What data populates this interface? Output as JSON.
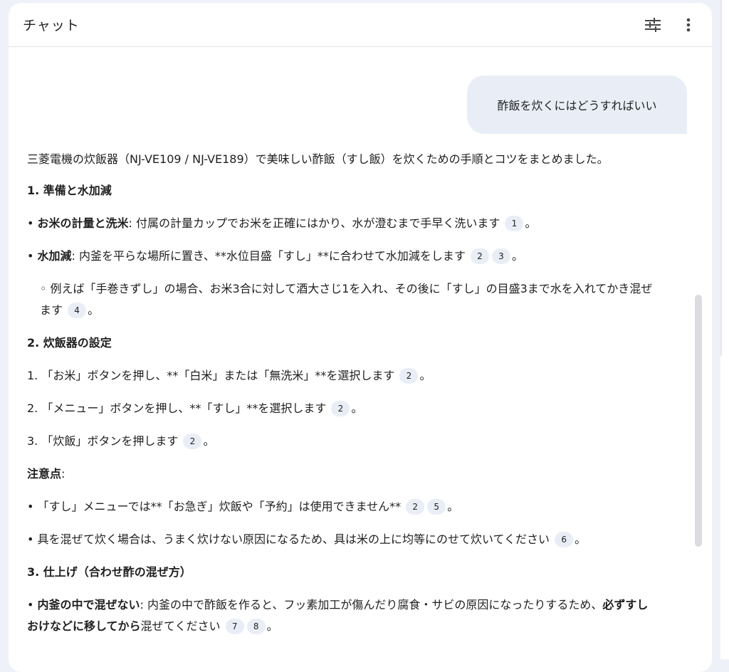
{
  "header": {
    "title": "チャット",
    "tune_icon": "tune-icon",
    "more_icon": "more-vert-icon"
  },
  "user_message": "酢飯を炊くにはどうすればいい",
  "answer": {
    "intro": "三菱電機の炊飯器（NJ-VE109 / NJ-VE189）で美味しい酢飯（すし飯）を炊くための手順とコツをまとめました。",
    "section1": "1. 準備と水加減",
    "s1_b1_bold": "お米の計量と洗米",
    "s1_b1_text": ": 付属の計量カップでお米を正確にはかり、水が澄むまで手早く洗います",
    "s1_b1_cites": [
      "1"
    ],
    "s1_b2_bold": "水加減",
    "s1_b2_text": ": 内釜を平らな場所に置き、**水位目盛「すし」**に合わせて水加減をします",
    "s1_b2_cites": [
      "2",
      "3"
    ],
    "s1_sub_text": "例えば「手巻きずし」の場合、お米3合に対して酒大さじ1を入れ、その後に「すし」の目盛3まで水を入れてかき混ぜます",
    "s1_sub_cites": [
      "4"
    ],
    "section2": "2. 炊飯器の設定",
    "s2_1": "1. 「お米」ボタンを押し、**「白米」または「無洗米」**を選択します",
    "s2_1_cites": [
      "2"
    ],
    "s2_2": "2. 「メニュー」ボタンを押し、**「すし」**を選択します",
    "s2_2_cites": [
      "2"
    ],
    "s2_3": "3. 「炊飯」ボタンを押します",
    "s2_3_cites": [
      "2"
    ],
    "note_heading": "注意点",
    "note_colon": ":",
    "note_b1": "「すし」メニューでは**「お急ぎ」炊飯や「予約」は使用できません**",
    "note_b1_cites": [
      "2",
      "5"
    ],
    "note_b2": "具を混ぜて炊く場合は、うまく炊けない原因になるため、具は米の上に均等にのせて炊いてください",
    "note_b2_cites": [
      "6"
    ],
    "section3": "3. 仕上げ（合わせ酢の混ぜ方）",
    "s3_b1_bold": "内釜の中で混ぜない",
    "s3_b1_text": ": 内釜の中で酢飯を作ると、フッ素加工が傷んだり腐食・サビの原因になったりするため、",
    "s3_b1_bold2": "必ずすしおけなどに移してから",
    "s3_b1_text2": "混ぜてください",
    "s3_b1_cites": [
      "7",
      "8"
    ],
    "period": "。",
    "bullet": "•",
    "circle": "◦"
  }
}
